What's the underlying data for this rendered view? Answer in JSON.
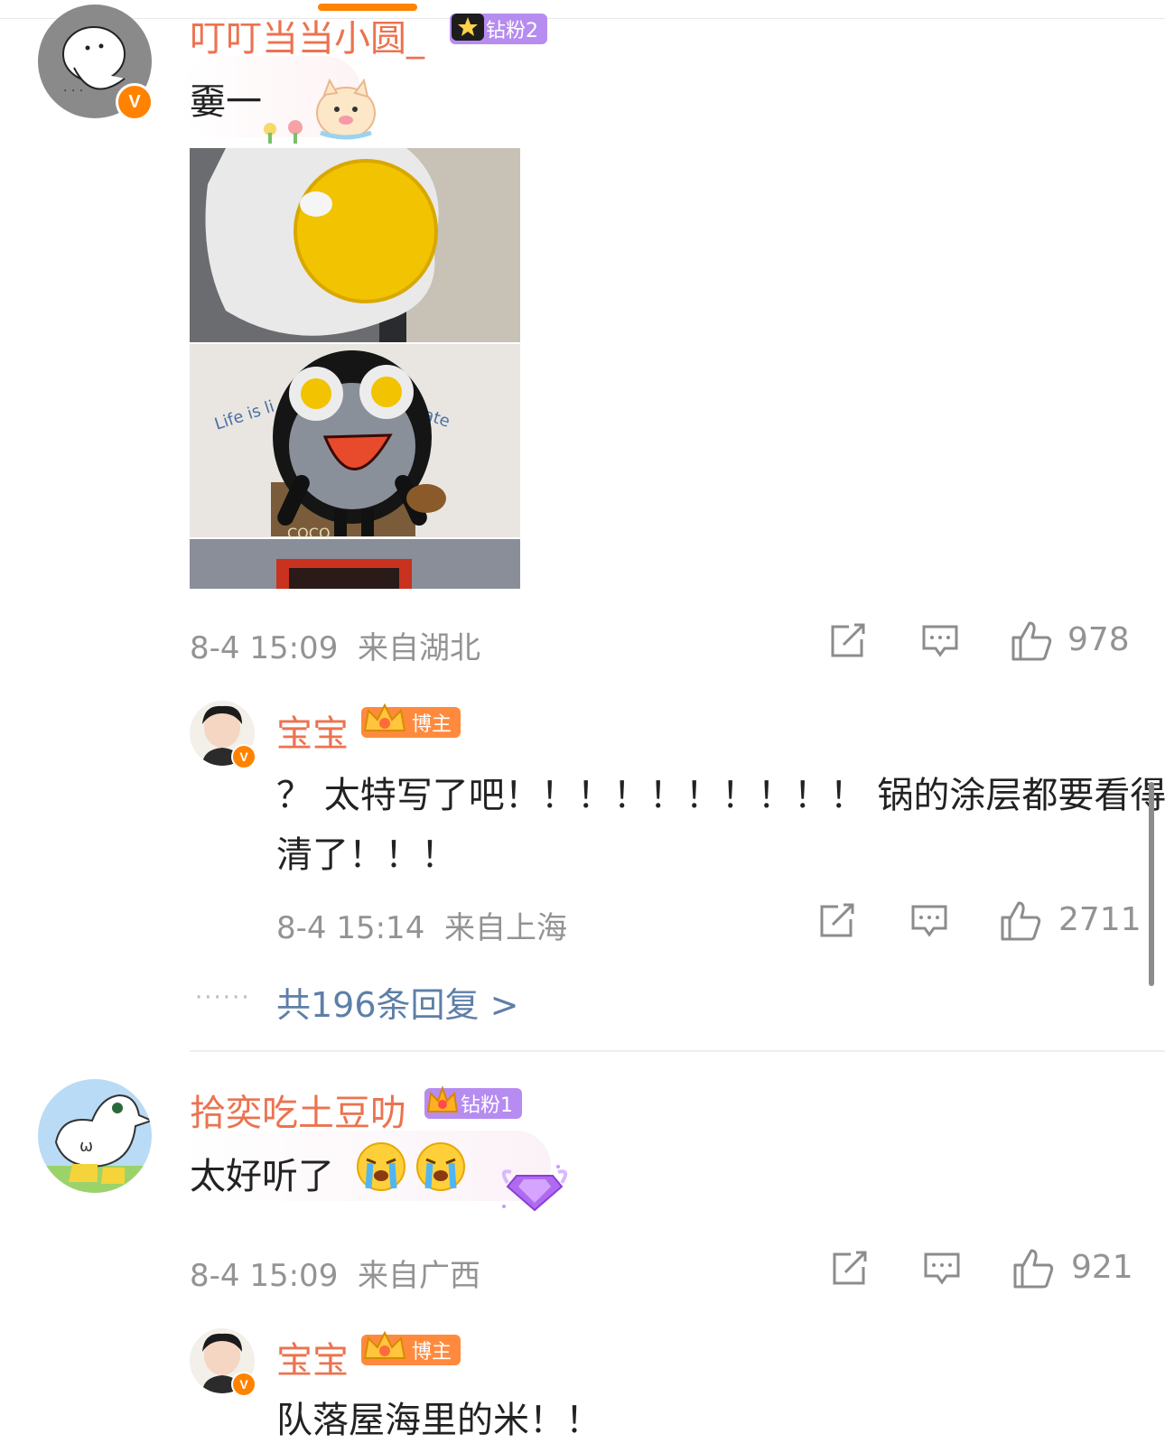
{
  "colors": {
    "accent": "#ff8200",
    "username": "#eb7350",
    "meta": "#939393",
    "link": "#5d7fa8",
    "fan_badge": "#b68cf0",
    "blogger_badge": "#ff8a3d"
  },
  "comments": [
    {
      "username": "叮叮当当小圆_",
      "badge": "钻粉2",
      "verified": true,
      "text": "嫑一",
      "time": "8-4 15:09",
      "location": "来自湖北",
      "likes": "978",
      "image_text": "Life is li",
      "image_text_right": "ate",
      "image_text_box": "COCO"
    },
    {
      "username": "拾奕吃土豆叻",
      "badge": "钻粉1",
      "verified": false,
      "text": "太好听了",
      "emoji": [
        "crying-face",
        "crying-face"
      ],
      "time": "8-4 15:09",
      "location": "来自广西",
      "likes": "921"
    }
  ],
  "replies": [
    {
      "username": "宝宝",
      "badge": "博主",
      "text_line1": "？ 太特写了吧！！！！！！！！！！ 锅的涂层都要看得",
      "text_line2": "清了！！！",
      "time": "8-4 15:14",
      "location": "来自上海",
      "likes": "2711",
      "reply_link": "共196条回复 >",
      "dots": "······"
    },
    {
      "username": "宝宝",
      "badge": "博主",
      "text_partial": "队落屋海里的米！！"
    }
  ]
}
